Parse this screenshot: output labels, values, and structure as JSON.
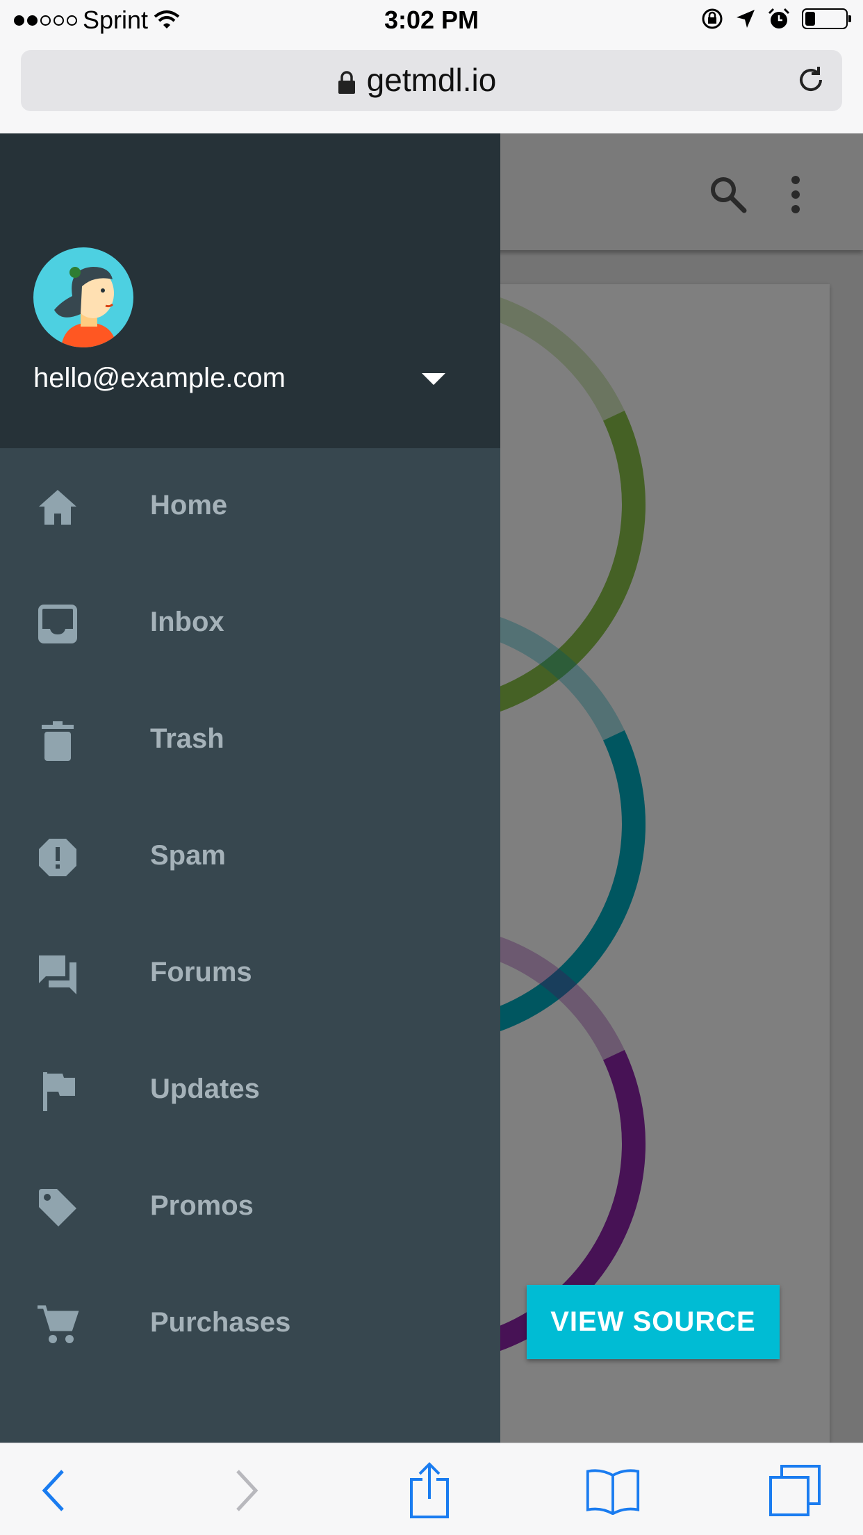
{
  "status_bar": {
    "carrier": "Sprint",
    "signal_filled": 2,
    "signal_total": 5,
    "time": "3:02 PM",
    "battery_level": 0.25,
    "icons": [
      "wifi-icon",
      "rotation-lock-icon",
      "location-arrow-icon",
      "alarm-icon",
      "battery-icon"
    ]
  },
  "browser": {
    "url": "getmdl.io",
    "icons": [
      "lock-icon",
      "reload-icon"
    ]
  },
  "app_header": {
    "icons": [
      "search-icon",
      "more-vert-icon"
    ]
  },
  "drawer": {
    "email": "hello@example.com",
    "nav_items": [
      {
        "label": "Home",
        "icon": "home-icon"
      },
      {
        "label": "Inbox",
        "icon": "inbox-icon"
      },
      {
        "label": "Trash",
        "icon": "trash-icon"
      },
      {
        "label": "Spam",
        "icon": "spam-icon"
      },
      {
        "label": "Forums",
        "icon": "forum-icon"
      },
      {
        "label": "Updates",
        "icon": "flag-icon"
      },
      {
        "label": "Promos",
        "icon": "tag-icon"
      },
      {
        "label": "Purchases",
        "icon": "cart-icon"
      }
    ]
  },
  "content": {
    "donut_suffix": "%",
    "donuts": [
      {
        "percent": 82,
        "color": "#8bc34a"
      },
      {
        "percent": 82,
        "color": "#00acc1"
      },
      {
        "percent": 82,
        "color": "#8e24aa"
      }
    ],
    "view_source_label": "VIEW SOURCE"
  },
  "colors": {
    "drawer_bg": "#37474f",
    "drawer_header_bg": "#263238",
    "accent": "#00bcd4"
  },
  "toolbar": {
    "icons": [
      "back-icon",
      "forward-icon",
      "share-icon",
      "bookmarks-icon",
      "tabs-icon"
    ]
  }
}
